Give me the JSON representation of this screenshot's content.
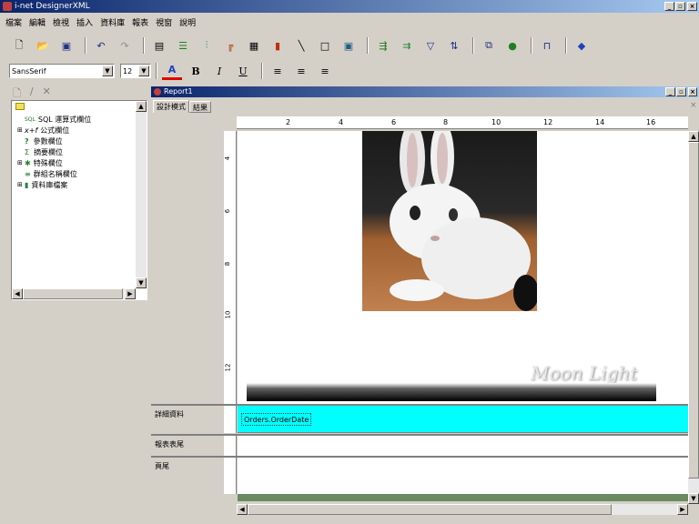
{
  "app": {
    "title": "i-net DesignerXML"
  },
  "menu": [
    "檔案",
    "編輯",
    "檢視",
    "插入",
    "資料庫",
    "報表",
    "視窗",
    "說明"
  ],
  "format": {
    "font": "SansSerif",
    "size": "12"
  },
  "tree": {
    "items": [
      {
        "icon_text": "SQL",
        "label": "SQL 運算式欄位"
      },
      {
        "icon_text": "x+f",
        "label": "公式欄位"
      },
      {
        "icon_text": "?",
        "label": "參數欄位"
      },
      {
        "icon_text": "Σ",
        "label": "摘要欄位"
      },
      {
        "icon_text": "✱",
        "label": "特殊欄位"
      },
      {
        "icon_text": "≡",
        "label": "群組名稱欄位"
      },
      {
        "icon_text": "▮",
        "label": "資料庫檔案"
      }
    ]
  },
  "report": {
    "window_title": "Report1",
    "tabs": [
      "設計模式",
      "結果"
    ],
    "ruler_top": [
      "2",
      "4",
      "6",
      "8",
      "10",
      "12",
      "14",
      "16"
    ],
    "ruler_left": [
      "4",
      "6",
      "8",
      "10",
      "12"
    ],
    "watermark": "Moon Light",
    "bands": [
      {
        "label": "詳細資料"
      },
      {
        "label": "報表表尾"
      },
      {
        "label": "頁尾"
      }
    ],
    "field": "Orders.OrderDate"
  },
  "colors": {
    "detail_band": "#00ffff",
    "titlebar": "#0a246a"
  }
}
